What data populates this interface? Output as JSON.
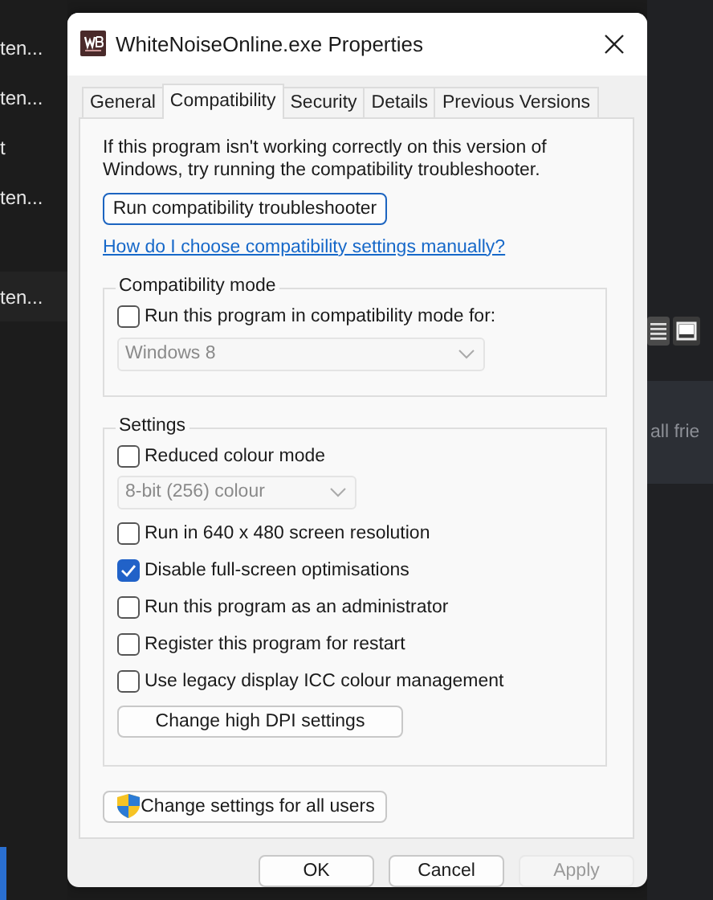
{
  "background": {
    "left_items": [
      {
        "label": "ten..."
      },
      {
        "label": "ten..."
      },
      {
        "label": "t"
      },
      {
        "label": "ten..."
      },
      {
        "label": "ten..."
      }
    ],
    "right_text": "all frie"
  },
  "window": {
    "title": "WhiteNoiseOnline.exe Properties"
  },
  "tabs": [
    {
      "label": "General",
      "selected": false
    },
    {
      "label": "Compatibility",
      "selected": true
    },
    {
      "label": "Security",
      "selected": false
    },
    {
      "label": "Details",
      "selected": false
    },
    {
      "label": "Previous Versions",
      "selected": false
    }
  ],
  "intro": "If this program isn't working correctly on this version of Windows, try running the compatibility troubleshooter.",
  "troubleshooter_button": "Run compatibility troubleshooter",
  "help_link": "How do I choose compatibility settings manually?",
  "compatibility_mode": {
    "title": "Compatibility mode",
    "checkbox": {
      "label": "Run this program in compatibility mode for:",
      "checked": false
    },
    "dropdown": {
      "value": "Windows 8",
      "disabled": true
    }
  },
  "settings": {
    "title": "Settings",
    "items": [
      {
        "kind": "checkbox",
        "label": "Reduced colour mode",
        "checked": false
      },
      {
        "kind": "dropdown",
        "value": "8-bit (256) colour",
        "disabled": true
      },
      {
        "kind": "checkbox",
        "label": "Run in 640 x 480 screen resolution",
        "checked": false
      },
      {
        "kind": "checkbox",
        "label": "Disable full-screen optimisations",
        "checked": true
      },
      {
        "kind": "checkbox",
        "label": "Run this program as an administrator",
        "checked": false
      },
      {
        "kind": "checkbox",
        "label": "Register this program for restart",
        "checked": false
      },
      {
        "kind": "checkbox",
        "label": "Use legacy display ICC colour management",
        "checked": false
      }
    ],
    "button": "Change high DPI settings"
  },
  "all_users_button": "Change settings for all users",
  "buttons": [
    {
      "label": "OK",
      "disabled": false
    },
    {
      "label": "Cancel",
      "disabled": false
    },
    {
      "label": "Apply",
      "disabled": true
    }
  ]
}
